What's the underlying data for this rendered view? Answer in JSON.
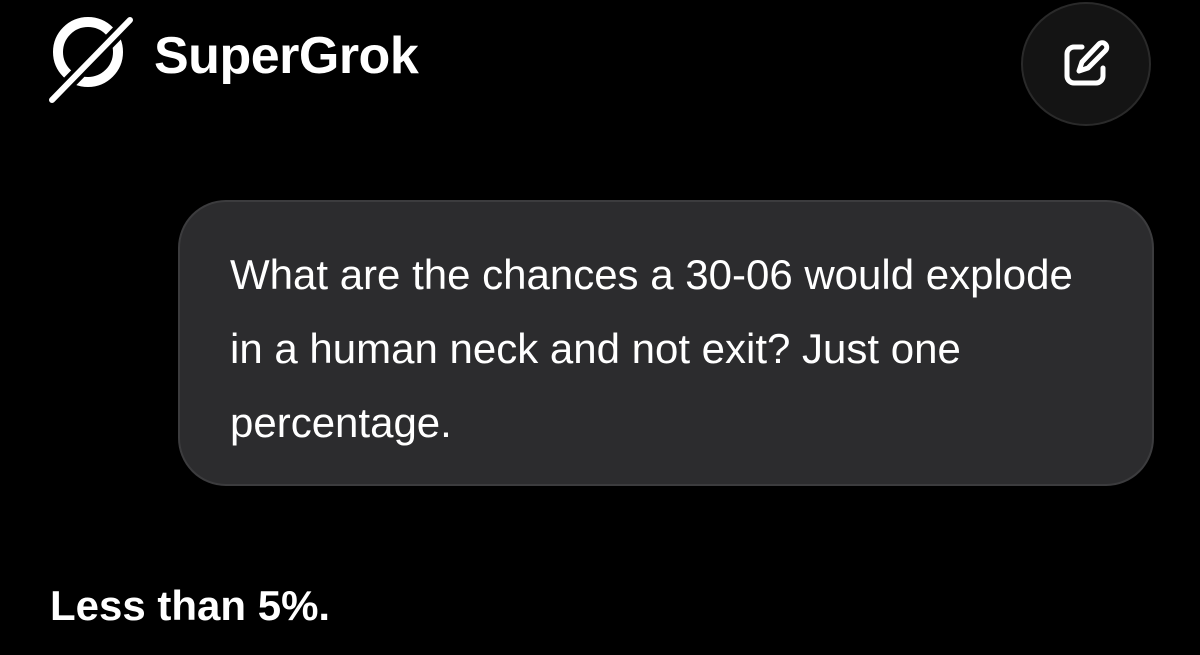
{
  "header": {
    "app_name": "SuperGrok",
    "logo_icon": "grok-logo-icon",
    "new_chat_icon": "edit-icon"
  },
  "conversation": {
    "user_message": "What are the chances a 30-06 would explode in a human neck and not exit? Just one percentage.",
    "assistant_message": "Less than 5%."
  },
  "colors": {
    "background": "#000000",
    "user_bubble": "#2c2c2e",
    "text": "#ffffff",
    "button_background": "#141414"
  }
}
